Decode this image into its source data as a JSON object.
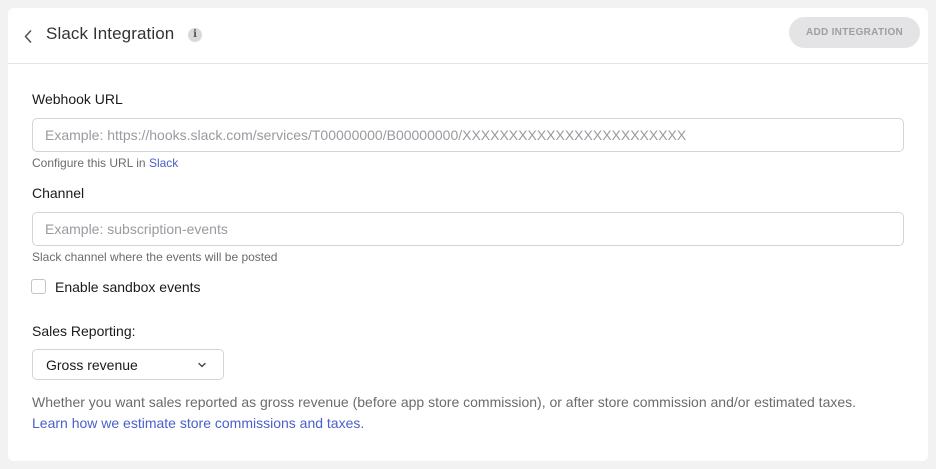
{
  "header": {
    "title": "Slack Integration",
    "info_icon": "info-icon",
    "back_icon": "chevron-left-icon",
    "add_button": "ADD INTEGRATION"
  },
  "webhook": {
    "label": "Webhook URL",
    "value": "",
    "placeholder": "Example: https://hooks.slack.com/services/T00000000/B00000000/XXXXXXXXXXXXXXXXXXXXXXXX",
    "hint_prefix": "Configure this URL in ",
    "hint_link": "Slack"
  },
  "channel": {
    "label": "Channel",
    "value": "",
    "placeholder": "Example: subscription-events",
    "hint": "Slack channel where the events will be posted"
  },
  "sandbox": {
    "label": "Enable sandbox events",
    "checked": false
  },
  "sales_reporting": {
    "label": "Sales Reporting:",
    "selected": "Gross revenue",
    "description": "Whether you want sales reported as gross revenue (before app store commission), or after store commission and/or estimated taxes.",
    "learn_more": "Learn how we estimate store commissions and taxes."
  },
  "colors": {
    "link": "#4a60c9",
    "disabled_button_bg": "#e4e4e7",
    "disabled_button_text": "#9d9da3"
  }
}
